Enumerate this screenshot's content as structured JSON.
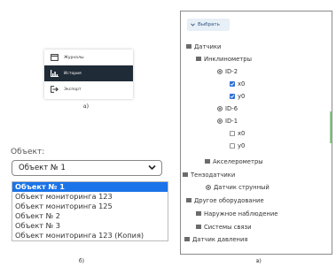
{
  "menu": {
    "items": [
      {
        "label": "Журналы",
        "icon": "journal-icon",
        "active": false
      },
      {
        "label": "История",
        "icon": "history-chart-icon",
        "active": true
      },
      {
        "label": "Экспорт",
        "icon": "export-icon",
        "active": false
      }
    ],
    "caption": "а)"
  },
  "object_select": {
    "label": "Объект:",
    "selected": "Объект № 1",
    "options": [
      "Объект № 1",
      "Объект мониторинга 123",
      "Объект мониторинга 125",
      "Объект № 2",
      "Объект № 3",
      "Объект мониторинга 123 (Копия)"
    ],
    "caption": "б)"
  },
  "tree_panel": {
    "select_button": "Выбрать",
    "items": [
      {
        "label": "Датчики",
        "icon": "folder-icon"
      },
      {
        "label": "Инклинометры",
        "icon": "folder-icon"
      },
      {
        "label": "ID-2",
        "icon": "sensor-icon"
      },
      {
        "label": "x0",
        "icon": "checkbox-checked-icon"
      },
      {
        "label": "y0",
        "icon": "checkbox-checked-icon"
      },
      {
        "label": "ID-6",
        "icon": "sensor-icon"
      },
      {
        "label": "ID-1",
        "icon": "sensor-icon"
      },
      {
        "label": "x0",
        "icon": "checkbox-empty-icon"
      },
      {
        "label": "y0",
        "icon": "checkbox-empty-icon"
      },
      {
        "label": "Акселерометры",
        "icon": "folder-icon"
      },
      {
        "label": "Тензодатчики",
        "icon": "folder-icon"
      },
      {
        "label": "Датчик струнный",
        "icon": "sensor-icon"
      },
      {
        "label": "Другое оборудование",
        "icon": "folder-icon"
      },
      {
        "label": "Наружное наблюдение",
        "icon": "folder-icon"
      },
      {
        "label": "Системы связи",
        "icon": "folder-icon"
      },
      {
        "label": "Датчик давления",
        "icon": "folder-icon"
      }
    ],
    "caption": "в)"
  },
  "colors": {
    "active_menu_bg": "#1f2b36",
    "selected_option_bg": "#1a73e8",
    "checkbox_blue": "#2f6fd6"
  }
}
